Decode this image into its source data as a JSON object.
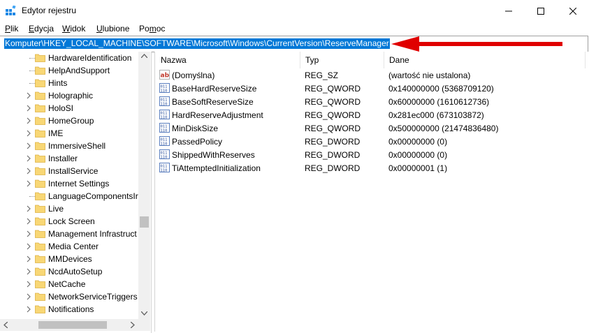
{
  "window": {
    "title": "Edytor rejestru"
  },
  "menu": [
    {
      "label": "Plik"
    },
    {
      "label": "Edycja"
    },
    {
      "label": "Widok"
    },
    {
      "label": "Ulubione"
    },
    {
      "label": "Pomoc"
    }
  ],
  "address": {
    "path": "Komputer\\HKEY_LOCAL_MACHINE\\SOFTWARE\\Microsoft\\Windows\\CurrentVersion\\ReserveManager"
  },
  "tree": [
    {
      "label": "HardwareIdentification",
      "expandable": false
    },
    {
      "label": "HelpAndSupport",
      "expandable": false
    },
    {
      "label": "Hints",
      "expandable": false
    },
    {
      "label": "Holographic",
      "expandable": true
    },
    {
      "label": "HoloSI",
      "expandable": true
    },
    {
      "label": "HomeGroup",
      "expandable": true
    },
    {
      "label": "IME",
      "expandable": true
    },
    {
      "label": "ImmersiveShell",
      "expandable": true
    },
    {
      "label": "Installer",
      "expandable": true
    },
    {
      "label": "InstallService",
      "expandable": true
    },
    {
      "label": "Internet Settings",
      "expandable": true
    },
    {
      "label": "LanguageComponentsIr",
      "expandable": false
    },
    {
      "label": "Live",
      "expandable": true
    },
    {
      "label": "Lock Screen",
      "expandable": true
    },
    {
      "label": "Management Infrastruct",
      "expandable": true
    },
    {
      "label": "Media Center",
      "expandable": true
    },
    {
      "label": "MMDevices",
      "expandable": true
    },
    {
      "label": "NcdAutoSetup",
      "expandable": true
    },
    {
      "label": "NetCache",
      "expandable": true
    },
    {
      "label": "NetworkServiceTriggers",
      "expandable": true
    },
    {
      "label": "Notifications",
      "expandable": true
    }
  ],
  "columns": {
    "name": "Nazwa",
    "type": "Typ",
    "data": "Dane"
  },
  "values": [
    {
      "name": "(Domyślna)",
      "type": "REG_SZ",
      "data": "(wartość nie ustalona)",
      "icon": "string-value-icon"
    },
    {
      "name": "BaseHardReserveSize",
      "type": "REG_QWORD",
      "data": "0x140000000 (5368709120)",
      "icon": "binary-value-icon"
    },
    {
      "name": "BaseSoftReserveSize",
      "type": "REG_QWORD",
      "data": "0x60000000 (1610612736)",
      "icon": "binary-value-icon"
    },
    {
      "name": "HardReserveAdjustment",
      "type": "REG_QWORD",
      "data": "0x281ec000 (673103872)",
      "icon": "binary-value-icon"
    },
    {
      "name": "MinDiskSize",
      "type": "REG_QWORD",
      "data": "0x500000000 (21474836480)",
      "icon": "binary-value-icon"
    },
    {
      "name": "PassedPolicy",
      "type": "REG_DWORD",
      "data": "0x00000000 (0)",
      "icon": "binary-value-icon"
    },
    {
      "name": "ShippedWithReserves",
      "type": "REG_DWORD",
      "data": "0x00000000 (0)",
      "icon": "binary-value-icon"
    },
    {
      "name": "TiAttemptedInitialization",
      "type": "REG_DWORD",
      "data": "0x00000001 (1)",
      "icon": "binary-value-icon"
    }
  ],
  "colors": {
    "selection": "#0078d7",
    "arrow": "#e00000",
    "folder": "#f8d775"
  }
}
